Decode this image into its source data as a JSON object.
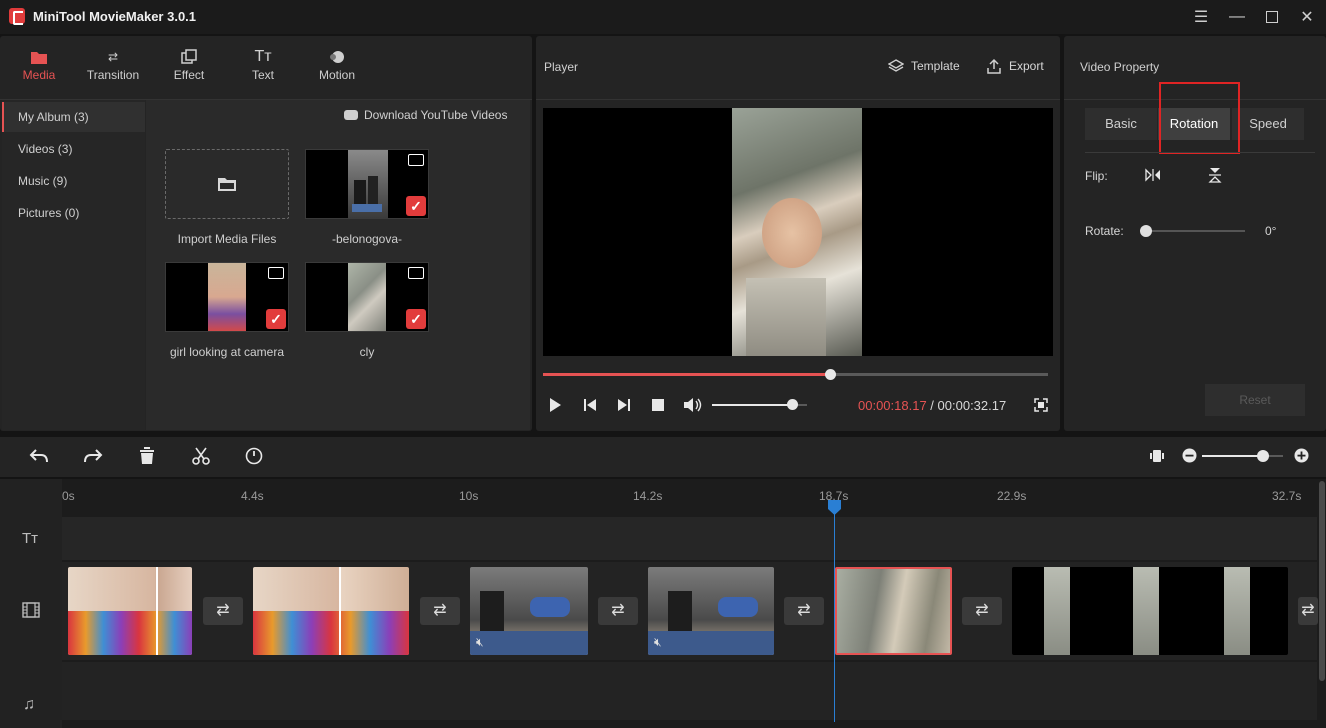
{
  "app": {
    "title": "MiniTool MovieMaker 3.0.1"
  },
  "toolbar": {
    "media": "Media",
    "transition": "Transition",
    "effect": "Effect",
    "text": "Text",
    "motion": "Motion"
  },
  "sidebar": {
    "items": [
      {
        "label": "My Album (3)"
      },
      {
        "label": "Videos (3)"
      },
      {
        "label": "Music (9)"
      },
      {
        "label": "Pictures (0)"
      }
    ]
  },
  "library": {
    "download_label": "Download YouTube Videos",
    "import_label": "Import Media Files",
    "items": [
      {
        "name": "-belonogova-"
      },
      {
        "name": "girl looking at camera"
      },
      {
        "name": "cly"
      }
    ]
  },
  "player": {
    "title": "Player",
    "template_label": "Template",
    "export_label": "Export",
    "current_time": "00:00:18.17",
    "separator": " / ",
    "total_time": "00:00:32.17",
    "progress": 0.57,
    "volume": 0.85
  },
  "property": {
    "title": "Video Property",
    "tabs": [
      "Basic",
      "Rotation",
      "Speed"
    ],
    "active_tab": "Rotation",
    "flip_label": "Flip:",
    "rotate_label": "Rotate:",
    "rotate_value": "0°",
    "reset_label": "Reset"
  },
  "timeline": {
    "ticks": [
      "0s",
      "4.4s",
      "10s",
      "14.2s",
      "18.7s",
      "22.9s",
      "32.7s"
    ],
    "zoom": 0.75
  },
  "colors": {
    "accent": "#e65353",
    "playhead": "#2a7fd4"
  }
}
